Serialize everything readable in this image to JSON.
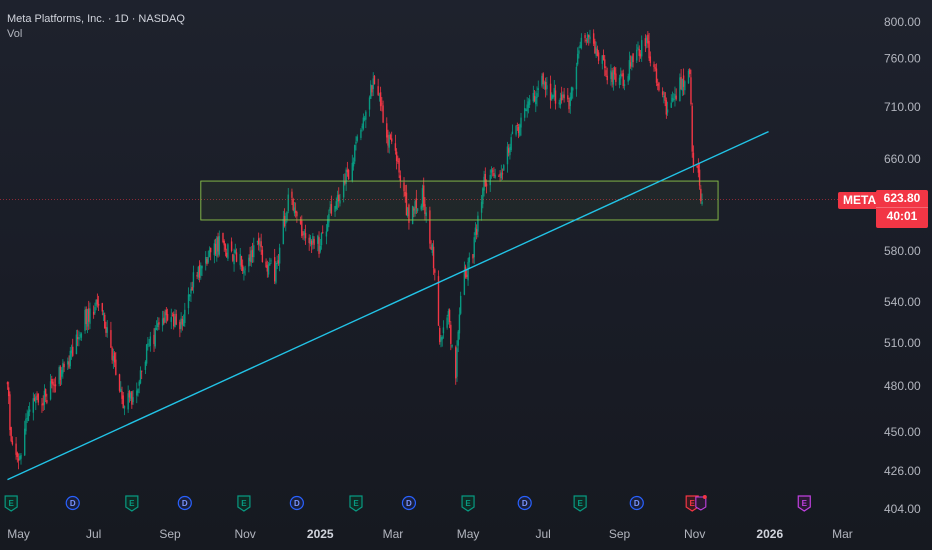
{
  "header": {
    "title": "Meta Platforms, Inc. · 1D · NASDAQ",
    "volume_label": "Vol"
  },
  "price_tag": {
    "symbol": "META",
    "price": "623.80",
    "countdown": "40:01",
    "color": "#f23645"
  },
  "colors": {
    "up": "#089981",
    "down": "#f23645",
    "trendline": "#22c3e6",
    "zone": "#8bc34a",
    "text": "#b2b5be"
  },
  "event_markers": [
    {
      "type": "E",
      "date": "2024-04-25"
    },
    {
      "type": "D",
      "date": "2024-06-14"
    },
    {
      "type": "E",
      "date": "2024-08-01"
    },
    {
      "type": "D",
      "date": "2024-09-13"
    },
    {
      "type": "E",
      "date": "2024-10-31"
    },
    {
      "type": "D",
      "date": "2024-12-13"
    },
    {
      "type": "E",
      "date": "2025-01-30"
    },
    {
      "type": "D",
      "date": "2025-03-14"
    },
    {
      "type": "E",
      "date": "2025-05-01"
    },
    {
      "type": "D",
      "date": "2025-06-16"
    },
    {
      "type": "E",
      "date": "2025-07-31"
    },
    {
      "type": "D",
      "date": "2025-09-15"
    },
    {
      "type": "E",
      "date": "2025-10-30"
    },
    {
      "type": "E",
      "date": "2026-01-29"
    }
  ],
  "chart_data": {
    "type": "candlestick",
    "symbol": "META",
    "interval": "1D",
    "exchange": "NASDAQ",
    "ylim": [
      404,
      800
    ],
    "y_scale": "log",
    "y_ticks": [
      800,
      760,
      710,
      660,
      623.8,
      580,
      540,
      510,
      480,
      450,
      426,
      404
    ],
    "y_tick_labels": [
      "800.00",
      "760.00",
      "710.00",
      "660.00",
      "623.80",
      "580.00",
      "540.00",
      "510.00",
      "480.00",
      "450.00",
      "426.00",
      "404.00"
    ],
    "x_range": [
      "2024-04-20",
      "2026-03-25"
    ],
    "x_ticks": [
      {
        "label": "May",
        "date": "2024-05-01",
        "year": false
      },
      {
        "label": "Jul",
        "date": "2024-07-01",
        "year": false
      },
      {
        "label": "Sep",
        "date": "2024-09-01",
        "year": false
      },
      {
        "label": "Nov",
        "date": "2024-11-01",
        "year": false
      },
      {
        "label": "2025",
        "date": "2025-01-01",
        "year": true
      },
      {
        "label": "Mar",
        "date": "2025-03-01",
        "year": false
      },
      {
        "label": "May",
        "date": "2025-05-01",
        "year": false
      },
      {
        "label": "Jul",
        "date": "2025-07-01",
        "year": false
      },
      {
        "label": "Sep",
        "date": "2025-09-01",
        "year": false
      },
      {
        "label": "Nov",
        "date": "2025-11-01",
        "year": false
      },
      {
        "label": "2026",
        "date": "2026-01-01",
        "year": true
      },
      {
        "label": "Mar",
        "date": "2026-03-01",
        "year": false
      }
    ],
    "price_path": [
      [
        "2024-04-22",
        481
      ],
      [
        "2024-04-25",
        441
      ],
      [
        "2024-04-30",
        430
      ],
      [
        "2024-05-10",
        467
      ],
      [
        "2024-05-24",
        473
      ],
      [
        "2024-06-05",
        491
      ],
      [
        "2024-06-14",
        503
      ],
      [
        "2024-06-25",
        530
      ],
      [
        "2024-07-05",
        539
      ],
      [
        "2024-07-15",
        505
      ],
      [
        "2024-07-25",
        468
      ],
      [
        "2024-08-05",
        475
      ],
      [
        "2024-08-15",
        510
      ],
      [
        "2024-08-28",
        526
      ],
      [
        "2024-09-10",
        522
      ],
      [
        "2024-09-20",
        559
      ],
      [
        "2024-10-01",
        572
      ],
      [
        "2024-10-10",
        586
      ],
      [
        "2024-10-25",
        573
      ],
      [
        "2024-11-01",
        567
      ],
      [
        "2024-11-12",
        584
      ],
      [
        "2024-11-25",
        560
      ],
      [
        "2024-12-06",
        624
      ],
      [
        "2024-12-18",
        597
      ],
      [
        "2024-12-31",
        585
      ],
      [
        "2025-01-10",
        615
      ],
      [
        "2025-01-24",
        647
      ],
      [
        "2025-02-05",
        704
      ],
      [
        "2025-02-14",
        737
      ],
      [
        "2025-02-24",
        683
      ],
      [
        "2025-03-05",
        655
      ],
      [
        "2025-03-14",
        607
      ],
      [
        "2025-03-25",
        626
      ],
      [
        "2025-04-04",
        567
      ],
      [
        "2025-04-08",
        510
      ],
      [
        "2025-04-15",
        530
      ],
      [
        "2025-04-21",
        484
      ],
      [
        "2025-04-25",
        550
      ],
      [
        "2025-05-05",
        580
      ],
      [
        "2025-05-15",
        643
      ],
      [
        "2025-05-27",
        643
      ],
      [
        "2025-06-06",
        680
      ],
      [
        "2025-06-16",
        700
      ],
      [
        "2025-06-30",
        738
      ],
      [
        "2025-07-10",
        720
      ],
      [
        "2025-07-22",
        712
      ],
      [
        "2025-07-31",
        773
      ],
      [
        "2025-08-08",
        785
      ],
      [
        "2025-08-20",
        748
      ],
      [
        "2025-09-02",
        737
      ],
      [
        "2025-09-12",
        755
      ],
      [
        "2025-09-22",
        778
      ],
      [
        "2025-10-03",
        727
      ],
      [
        "2025-10-10",
        705
      ],
      [
        "2025-10-20",
        733
      ],
      [
        "2025-10-28",
        751
      ],
      [
        "2025-10-30",
        666
      ],
      [
        "2025-11-05",
        636
      ],
      [
        "2025-11-07",
        623.8
      ]
    ],
    "annotations": {
      "trendline": {
        "start": [
          "2024-04-22",
          421
        ],
        "end": [
          "2025-12-31",
          686
        ]
      },
      "zone": {
        "start_date": "2024-09-26",
        "end_date": "2025-11-20",
        "top": 640,
        "bottom": 606
      }
    }
  }
}
